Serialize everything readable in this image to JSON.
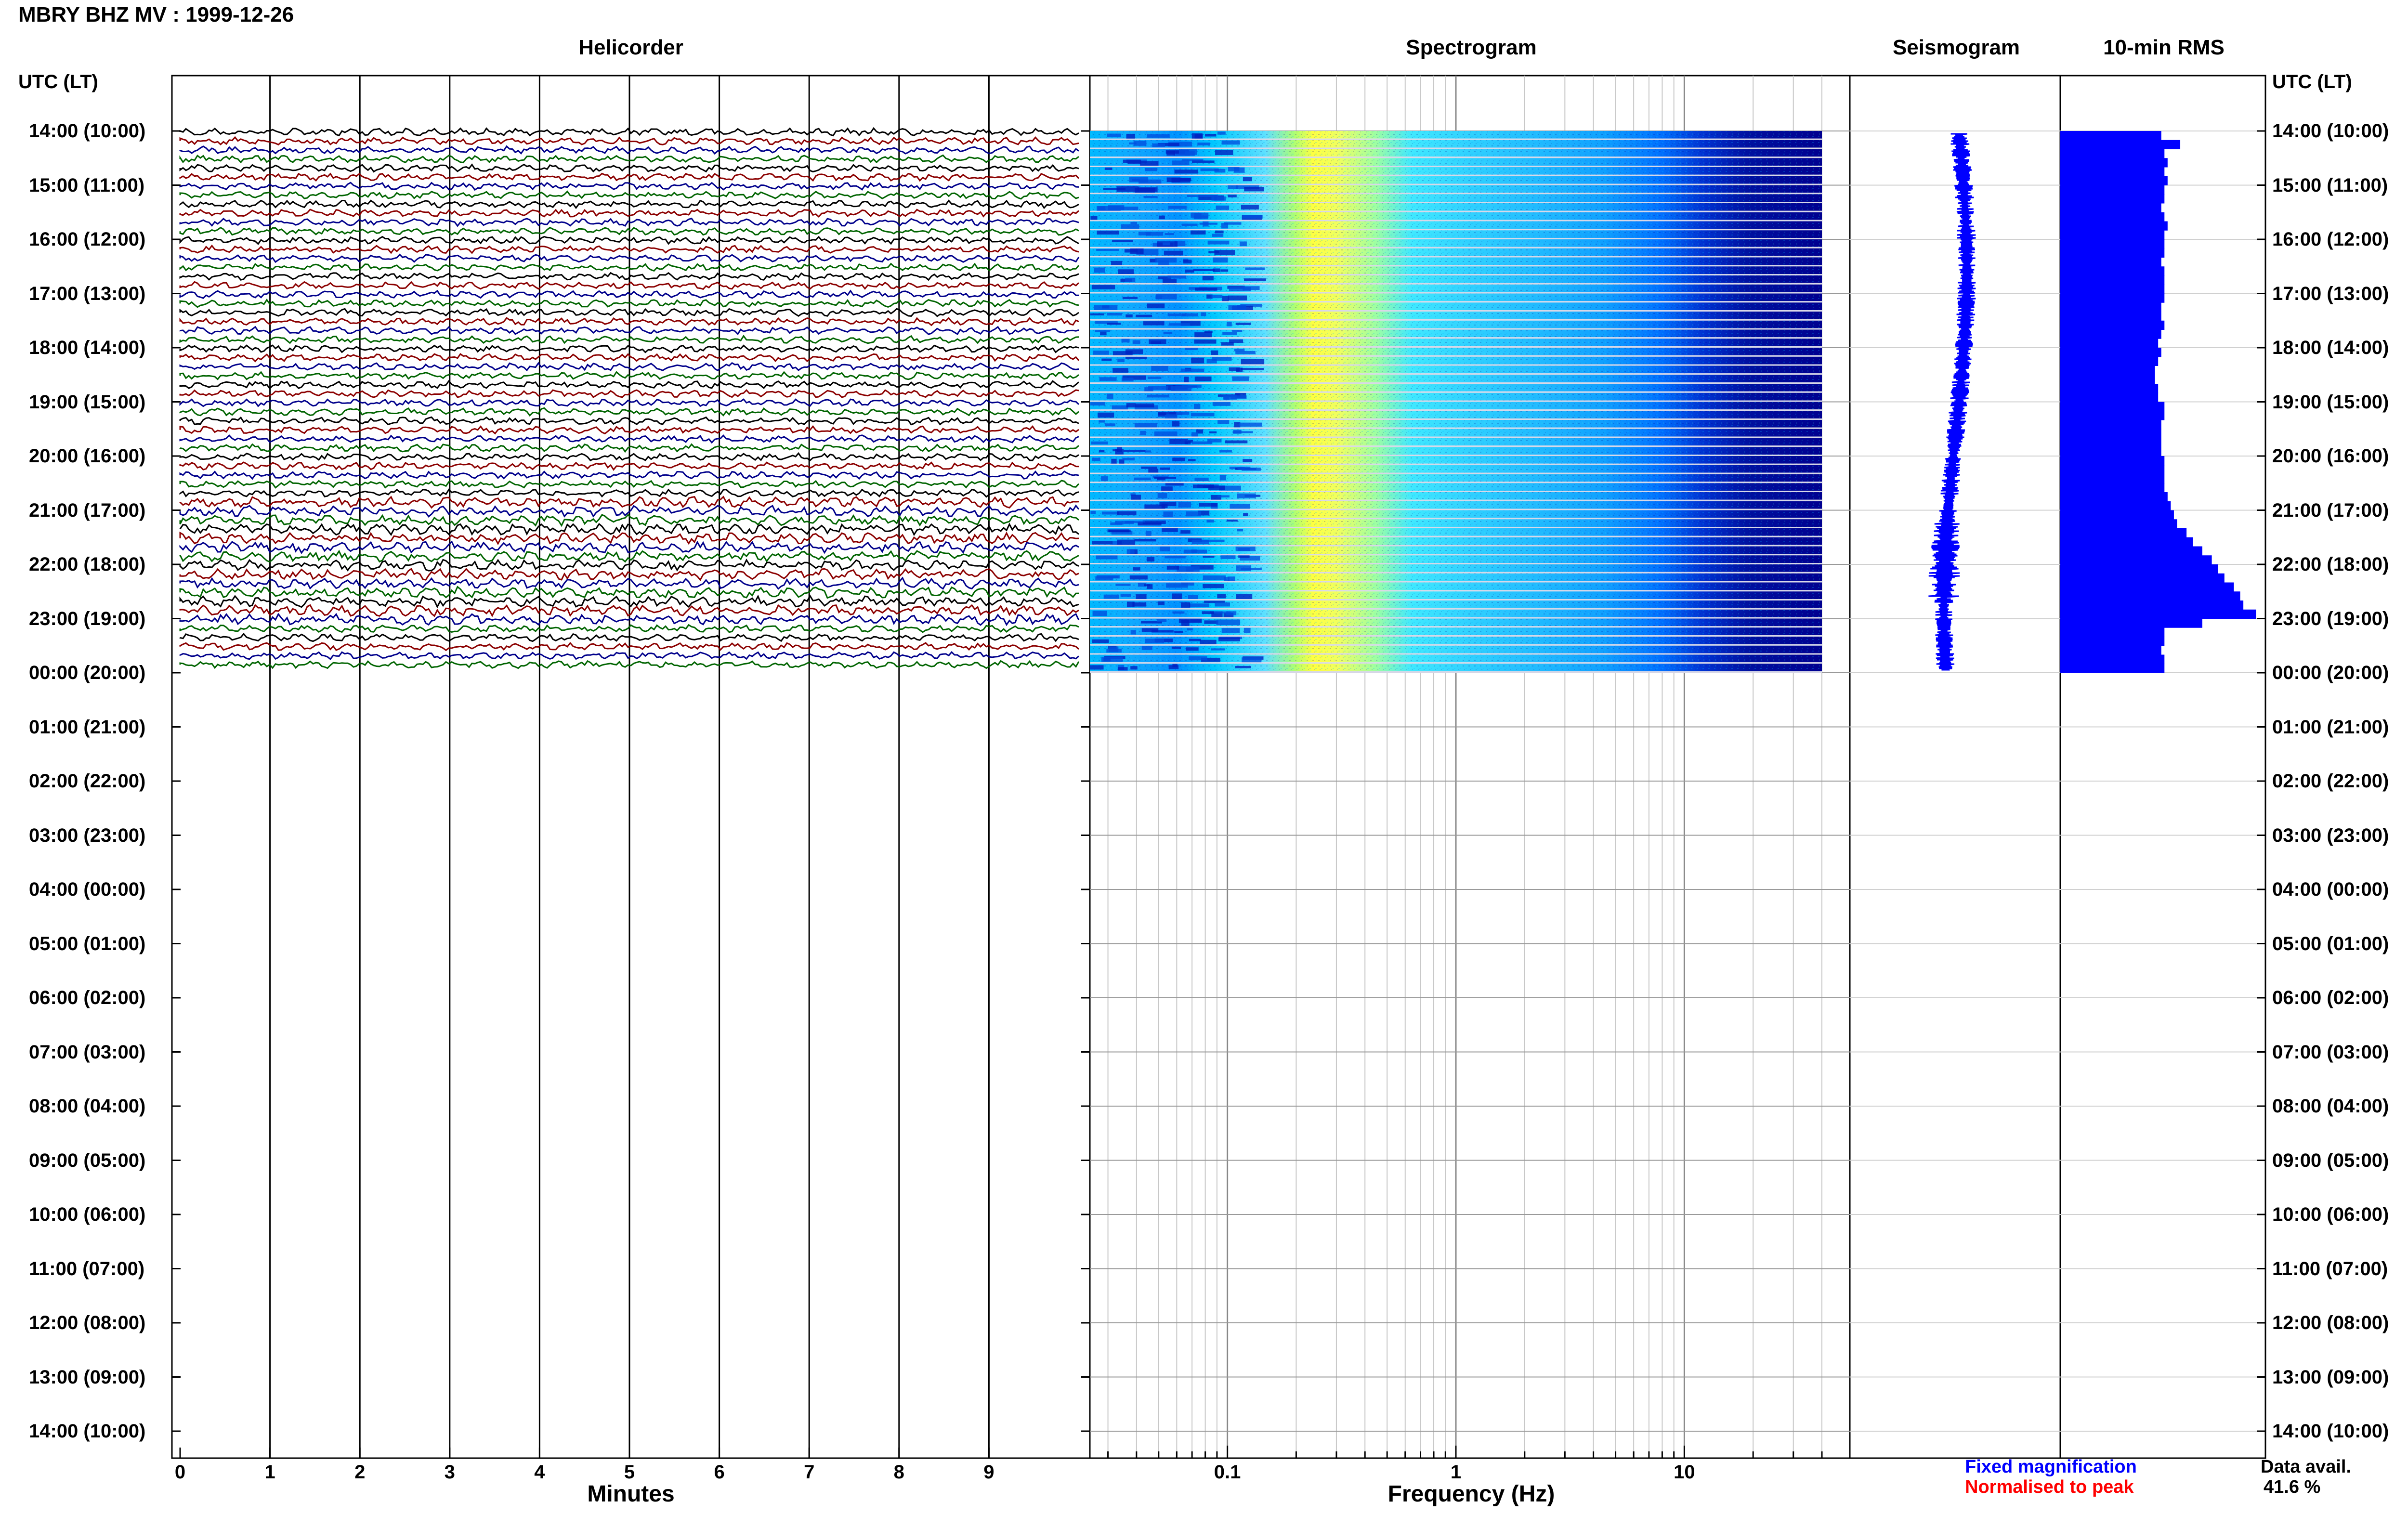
{
  "title": "MBRY BHZ MV : 1999-12-26",
  "panels": {
    "helicorder": "Helicorder",
    "spectrogram": "Spectrogram",
    "seismogram": "Seismogram",
    "rms": "10-min RMS"
  },
  "utc_header_left": "UTC (LT)",
  "utc_header_right": "UTC (LT)",
  "legend": {
    "fixed": "Fixed magnification",
    "normalised": "Normalised to peak",
    "fixed_color": "#0000ff",
    "normalised_color": "#ff0000"
  },
  "data_avail": {
    "label": "Data avail.",
    "value": "41.6 %"
  },
  "colors": {
    "trace_cycle": [
      "#000000",
      "#8b0000",
      "#00008b",
      "#006400"
    ],
    "rms_fill": "#0000ff",
    "seismogram": "#0000ff"
  },
  "chart_data": {
    "type": "heatmap",
    "time_labels": [
      "14:00 (10:00)",
      "15:00 (11:00)",
      "16:00 (12:00)",
      "17:00 (13:00)",
      "18:00 (14:00)",
      "19:00 (15:00)",
      "20:00 (16:00)",
      "21:00 (17:00)",
      "22:00 (18:00)",
      "23:00 (19:00)",
      "00:00 (20:00)",
      "01:00 (21:00)",
      "02:00 (22:00)",
      "03:00 (23:00)",
      "04:00 (00:00)",
      "05:00 (01:00)",
      "06:00 (02:00)",
      "07:00 (03:00)",
      "08:00 (04:00)",
      "09:00 (05:00)",
      "10:00 (06:00)",
      "11:00 (07:00)",
      "12:00 (08:00)",
      "13:00 (09:00)",
      "14:00 (10:00)"
    ],
    "data_hours": 10,
    "helicorder": {
      "xlabel": "Minutes",
      "xticks": [
        "0",
        "1",
        "2",
        "3",
        "4",
        "5",
        "6",
        "7",
        "8",
        "9"
      ],
      "xlim": [
        0,
        10
      ],
      "trace_minutes": 10,
      "traces": 60
    },
    "spectrogram": {
      "xlabel": "Frequency (Hz)",
      "xscale": "log",
      "xlim": [
        0.025,
        40
      ],
      "xticks": [
        "0.1",
        "1",
        "10"
      ],
      "peak_band_hz": [
        0.18,
        0.5
      ],
      "rows": 60
    },
    "rms": {
      "rows": 60,
      "values": [
        0.32,
        0.38,
        0.33,
        0.34,
        0.33,
        0.34,
        0.33,
        0.33,
        0.32,
        0.33,
        0.34,
        0.33,
        0.33,
        0.33,
        0.32,
        0.33,
        0.33,
        0.33,
        0.33,
        0.32,
        0.32,
        0.33,
        0.32,
        0.31,
        0.32,
        0.31,
        0.3,
        0.3,
        0.31,
        0.31,
        0.33,
        0.33,
        0.32,
        0.32,
        0.32,
        0.32,
        0.33,
        0.33,
        0.33,
        0.33,
        0.34,
        0.35,
        0.36,
        0.37,
        0.4,
        0.42,
        0.45,
        0.48,
        0.5,
        0.52,
        0.55,
        0.57,
        0.58,
        0.62,
        0.45,
        0.33,
        0.33,
        0.32,
        0.33,
        0.33
      ],
      "xlim": [
        0,
        0.65
      ]
    }
  }
}
